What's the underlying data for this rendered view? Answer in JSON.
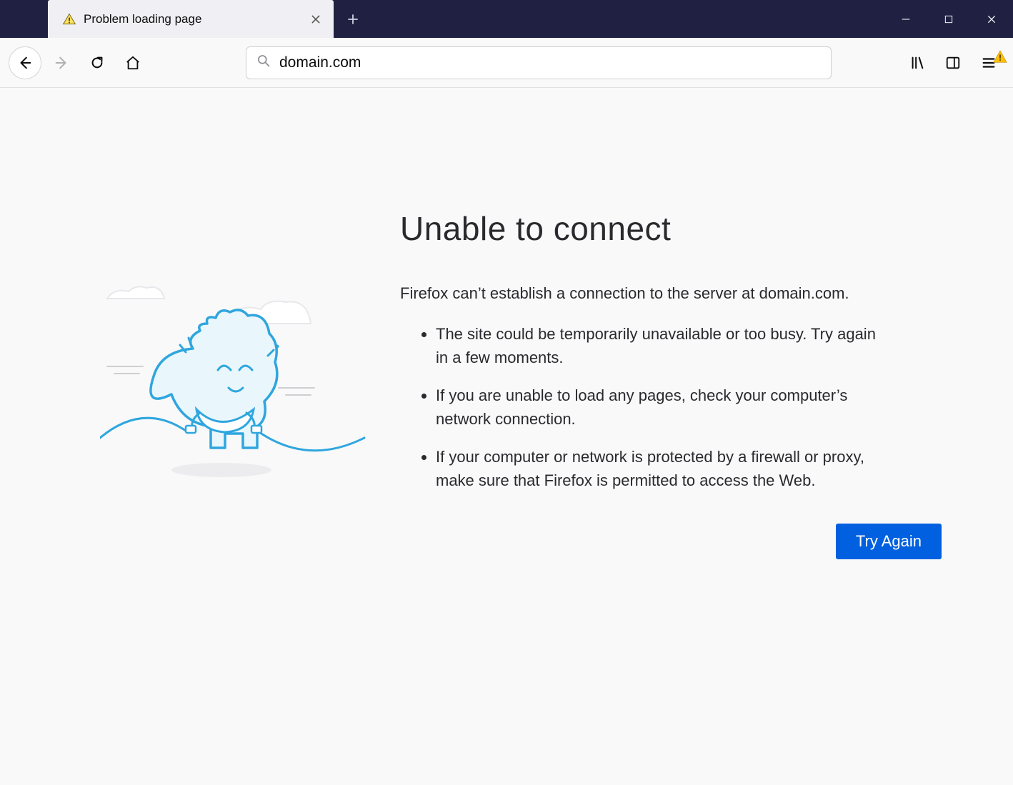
{
  "window": {
    "tab_title": "Problem loading page"
  },
  "toolbar": {
    "url": "domain.com"
  },
  "error": {
    "title": "Unable to connect",
    "description": "Firefox can’t establish a connection to the server at domain.com.",
    "bullets": [
      "The site could be temporarily unavailable or too busy. Try again in a few moments.",
      "If you are unable to load any pages, check your computer’s network connection.",
      "If your computer or network is protected by a firewall or proxy, make sure that Firefox is permitted to access the Web."
    ],
    "retry_label": "Try Again"
  }
}
